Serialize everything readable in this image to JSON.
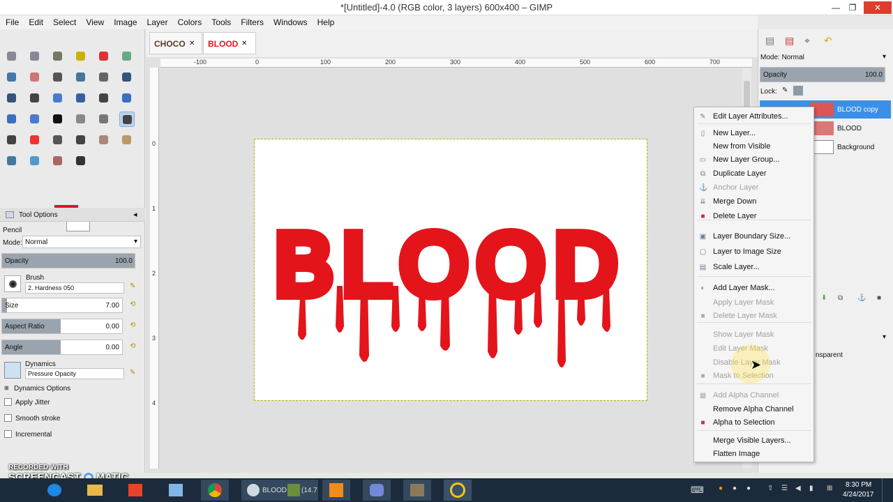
{
  "window": {
    "title": "*[Untitled]-4.0 (RGB color, 3 layers) 600x400 – GIMP",
    "minimize": "—",
    "maximize": "❐",
    "close": "✕"
  },
  "menubar": [
    "File",
    "Edit",
    "Select",
    "View",
    "Image",
    "Layer",
    "Colors",
    "Tools",
    "Filters",
    "Windows",
    "Help"
  ],
  "image_tabs": [
    {
      "label": "CHOCO",
      "color": "#5a3a2a",
      "close": "✕"
    },
    {
      "label": "BLOOD",
      "color": "#e4141b",
      "close": "✕"
    }
  ],
  "ruler_h": [
    "-100",
    "0",
    "100",
    "200",
    "300",
    "400",
    "500",
    "600",
    "700"
  ],
  "ruler_v": [
    "0",
    "1",
    "2",
    "3",
    "4"
  ],
  "canvas": {
    "text": "BLOOD",
    "text_color": "#e4141b"
  },
  "colors": {
    "foreground": "#e4141b",
    "background": "#ffffff",
    "accent": "#3c8fe6"
  },
  "tool_options": {
    "panel_title": "Tool Options",
    "tool_name": "Pencil",
    "mode_label": "Mode:",
    "mode_value": "Normal",
    "opacity_label": "Opacity",
    "opacity_value": "100.0",
    "brush_label": "Brush",
    "brush_value": "2. Hardness 050",
    "size_label": "Size",
    "size_value": "7.00",
    "aspect_label": "Aspect Ratio",
    "aspect_value": "0.00",
    "angle_label": "Angle",
    "angle_value": "0.00",
    "dynamics_label": "Dynamics",
    "dynamics_value": "Pressure Opacity",
    "dynamics_options": "Dynamics Options",
    "apply_jitter": "Apply Jitter",
    "smooth_stroke": "Smooth stroke",
    "incremental": "Incremental"
  },
  "layers_panel": {
    "mode_label": "Mode: Normal",
    "opacity_label": "Opacity",
    "opacity_value": "100.0",
    "lock_label": "Lock:",
    "layers": [
      "BLOOD copy",
      "BLOOD",
      "Background"
    ],
    "partial_text": "nsparent"
  },
  "context_menu": [
    {
      "label": "Edit Layer Attributes...",
      "icon": "edit-icon",
      "glyph": "✎",
      "disabled": false
    },
    {
      "sep": true
    },
    {
      "label": "New Layer...",
      "icon": "new-layer-icon",
      "glyph": "▯",
      "disabled": false
    },
    {
      "label": "New from Visible",
      "icon": "",
      "glyph": "",
      "disabled": false
    },
    {
      "label": "New Layer Group...",
      "icon": "folder-icon",
      "glyph": "▭",
      "disabled": false
    },
    {
      "label": "Duplicate Layer",
      "icon": "duplicate-icon",
      "glyph": "⧉",
      "disabled": false
    },
    {
      "label": "Anchor Layer",
      "icon": "anchor-icon",
      "glyph": "⚓",
      "disabled": true
    },
    {
      "label": "Merge Down",
      "icon": "merge-icon",
      "glyph": "⇊",
      "disabled": false
    },
    {
      "label": "Delete Layer",
      "icon": "delete-icon",
      "glyph": "■",
      "disabled": false
    },
    {
      "sep": true
    },
    {
      "label": "Layer Boundary Size...",
      "icon": "boundary-icon",
      "glyph": "▣",
      "disabled": false
    },
    {
      "label": "Layer to Image Size",
      "icon": "fit-icon",
      "glyph": "▢",
      "disabled": false
    },
    {
      "label": "Scale Layer...",
      "icon": "scale-icon",
      "glyph": "▤",
      "disabled": false
    },
    {
      "sep": true
    },
    {
      "label": "Add Layer Mask...",
      "icon": "mask-icon",
      "glyph": "◐",
      "disabled": false
    },
    {
      "label": "Apply Layer Mask",
      "icon": "",
      "glyph": "",
      "disabled": true
    },
    {
      "label": "Delete Layer Mask",
      "icon": "delete-mask-icon",
      "glyph": "■",
      "disabled": true
    },
    {
      "sep": true
    },
    {
      "label": "Show Layer Mask",
      "icon": "",
      "glyph": "",
      "disabled": true
    },
    {
      "label": "Edit Layer Mask",
      "icon": "",
      "glyph": "",
      "disabled": true
    },
    {
      "label": "Disable Layer Mask",
      "icon": "",
      "glyph": "",
      "disabled": true
    },
    {
      "label": "Mask to Selection",
      "icon": "mask-selection-icon",
      "glyph": "■",
      "disabled": true
    },
    {
      "sep": true
    },
    {
      "label": "Add Alpha Channel",
      "icon": "alpha-icon",
      "glyph": "▦",
      "disabled": true
    },
    {
      "label": "Remove Alpha Channel",
      "icon": "",
      "glyph": "",
      "disabled": false
    },
    {
      "label": "Alpha to Selection",
      "icon": "alpha-selection-icon",
      "glyph": "■",
      "disabled": false
    },
    {
      "sep": true
    },
    {
      "label": "Merge Visible Layers...",
      "icon": "",
      "glyph": "",
      "disabled": false
    },
    {
      "label": "Flatten Image",
      "icon": "",
      "glyph": "",
      "disabled": false
    }
  ],
  "watermark": {
    "line1": "RECORDED WITH",
    "line2": "SCREENCAST",
    "line3": "MATIC"
  },
  "taskbar": {
    "time": "8:30 PM",
    "date": "4/24/2017",
    "items": [
      "BLOOD",
      "(14.7"
    ]
  }
}
